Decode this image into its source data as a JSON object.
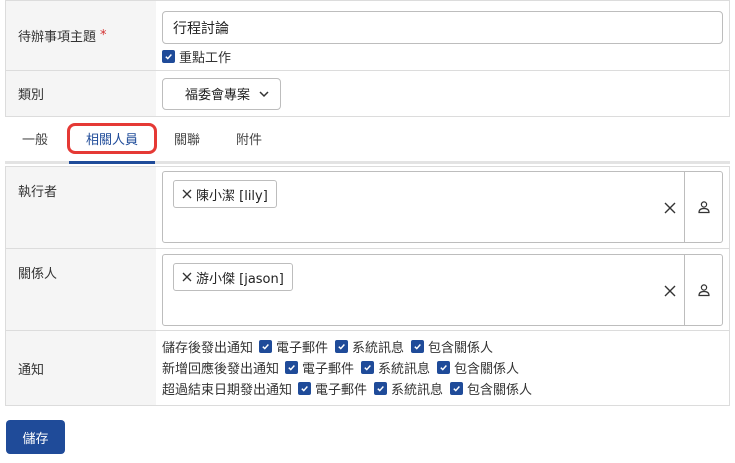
{
  "fields": {
    "subject": {
      "label": "待辦事項主題",
      "required_mark": "*",
      "value": "行程討論",
      "important_label": "重點工作"
    },
    "category": {
      "label": "類別",
      "value": "福委會專案"
    }
  },
  "tabs": [
    {
      "label": "一般"
    },
    {
      "label": "相關人員"
    },
    {
      "label": "關聯"
    },
    {
      "label": "附件"
    }
  ],
  "executor": {
    "label": "執行者",
    "tag": "陳小潔 [lily]"
  },
  "related": {
    "label": "關係人",
    "tag": "游小傑 [jason]"
  },
  "notify": {
    "label": "通知",
    "lines": [
      {
        "lead": "儲存後發出通知",
        "opts": [
          "電子郵件",
          "系統訊息",
          "包含關係人"
        ]
      },
      {
        "lead": "新增回應後發出通知",
        "opts": [
          "電子郵件",
          "系統訊息",
          "包含關係人"
        ]
      },
      {
        "lead": "超過結束日期發出通知",
        "opts": [
          "電子郵件",
          "系統訊息",
          "包含關係人"
        ]
      }
    ]
  },
  "save_label": "儲存",
  "colors": {
    "primary": "#1f4b99",
    "highlight": "#e53935",
    "required": "#d32f2f"
  }
}
